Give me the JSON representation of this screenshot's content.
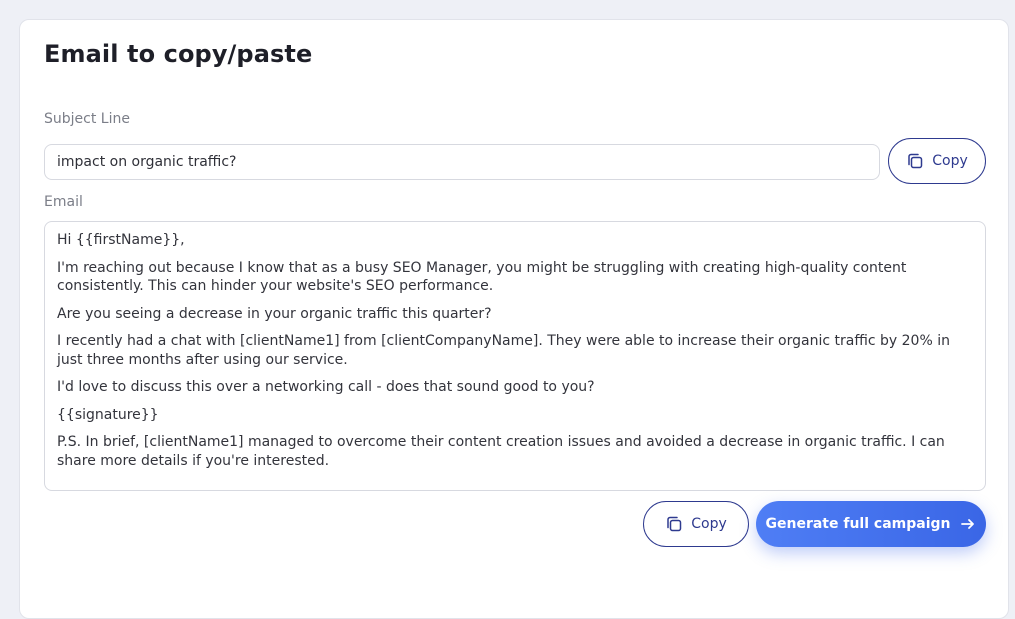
{
  "panel": {
    "title": "Email to copy/paste"
  },
  "subject": {
    "label": "Subject Line",
    "value": "impact on organic traffic?",
    "copy_label": "Copy"
  },
  "email": {
    "label": "Email",
    "paragraphs": [
      "Hi {{firstName}},",
      "I'm reaching out because I know that as a busy SEO Manager, you might be struggling with creating high-quality content consistently. This can hinder your website's SEO performance.",
      "Are you seeing a decrease in your organic traffic this quarter?",
      "I recently had a chat with [clientName1] from [clientCompanyName]. They were able to increase their organic traffic by 20% in just three months after using our service.",
      "I'd love to discuss this over a networking call - does that sound good to you?",
      "{{signature}}",
      "P.S. In brief, [clientName1] managed to overcome their content creation issues and avoided a decrease in organic traffic. I can share more details if you're interested."
    ],
    "copy_label": "Copy"
  },
  "actions": {
    "generate_label": "Generate full campaign"
  },
  "icons": {
    "copy": "copy-icon",
    "arrow": "arrow-right-icon"
  },
  "colors": {
    "accent": "#2e3a8f",
    "primary_button": "#4a78f0"
  }
}
